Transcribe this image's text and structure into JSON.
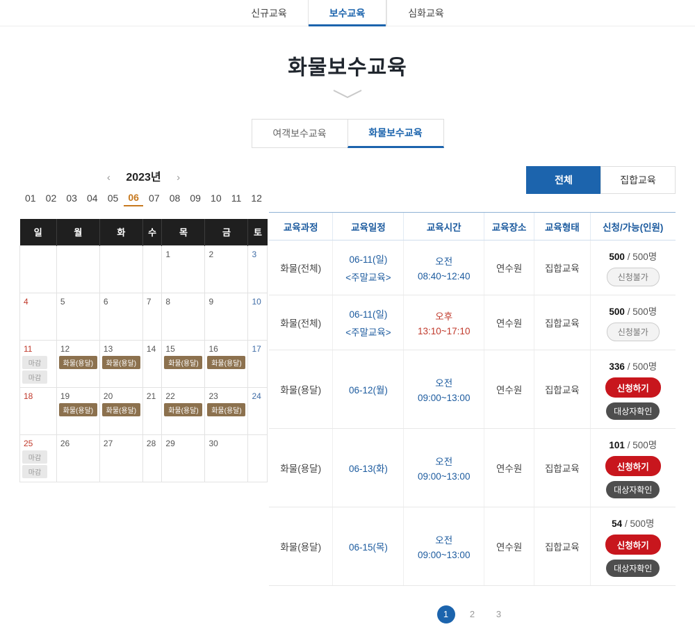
{
  "top_nav": {
    "tabs": [
      {
        "label": "신규교육",
        "active": false
      },
      {
        "label": "보수교육",
        "active": true
      },
      {
        "label": "심화교육",
        "active": false
      }
    ]
  },
  "page": {
    "title": "화물보수교육"
  },
  "sub_tabs": [
    {
      "label": "여객보수교육",
      "active": false
    },
    {
      "label": "화물보수교육",
      "active": true
    }
  ],
  "calendar": {
    "prev_label": "‹",
    "next_label": "›",
    "year": "2023년",
    "months": [
      "01",
      "02",
      "03",
      "04",
      "05",
      "06",
      "07",
      "08",
      "09",
      "10",
      "11",
      "12"
    ],
    "selected_month": "06",
    "weekdays": [
      "일",
      "월",
      "화",
      "수",
      "목",
      "금",
      "토"
    ],
    "weeks": [
      [
        {
          "day": ""
        },
        {
          "day": ""
        },
        {
          "day": ""
        },
        {
          "day": ""
        },
        {
          "day": "1"
        },
        {
          "day": "2"
        },
        {
          "day": "3",
          "type": "sat"
        }
      ],
      [
        {
          "day": "4",
          "type": "sun"
        },
        {
          "day": "5"
        },
        {
          "day": "6"
        },
        {
          "day": "7"
        },
        {
          "day": "8"
        },
        {
          "day": "9"
        },
        {
          "day": "10",
          "type": "sat"
        }
      ],
      [
        {
          "day": "11",
          "type": "sun",
          "badges": [
            {
              "label": "마감",
              "style": "closed"
            },
            {
              "label": "마감",
              "style": "closed"
            }
          ]
        },
        {
          "day": "12",
          "badges": [
            {
              "label": "화물(용달)",
              "style": "cargo"
            }
          ]
        },
        {
          "day": "13",
          "badges": [
            {
              "label": "화물(용달)",
              "style": "cargo"
            }
          ]
        },
        {
          "day": "14"
        },
        {
          "day": "15",
          "badges": [
            {
              "label": "화물(용달)",
              "style": "cargo"
            }
          ]
        },
        {
          "day": "16",
          "badges": [
            {
              "label": "화물(용달)",
              "style": "cargo"
            }
          ]
        },
        {
          "day": "17",
          "type": "sat"
        }
      ],
      [
        {
          "day": "18",
          "type": "sun"
        },
        {
          "day": "19",
          "badges": [
            {
              "label": "화물(용달)",
              "style": "cargo"
            }
          ]
        },
        {
          "day": "20",
          "badges": [
            {
              "label": "화물(용달)",
              "style": "cargo"
            }
          ]
        },
        {
          "day": "21"
        },
        {
          "day": "22",
          "badges": [
            {
              "label": "화물(용달)",
              "style": "cargo"
            }
          ]
        },
        {
          "day": "23",
          "badges": [
            {
              "label": "화물(용달)",
              "style": "cargo"
            }
          ]
        },
        {
          "day": "24",
          "type": "sat"
        }
      ],
      [
        {
          "day": "25",
          "type": "sun",
          "badges": [
            {
              "label": "마감",
              "style": "closed"
            },
            {
              "label": "마감",
              "style": "closed"
            }
          ]
        },
        {
          "day": "26"
        },
        {
          "day": "27"
        },
        {
          "day": "28"
        },
        {
          "day": "29"
        },
        {
          "day": "30"
        },
        {
          "day": ""
        }
      ]
    ]
  },
  "filters": [
    {
      "label": "전체",
      "active": true
    },
    {
      "label": "집합교육",
      "active": false
    }
  ],
  "table": {
    "headers": [
      "교육과정",
      "교육일정",
      "교육시간",
      "교육장소",
      "교육형태",
      "신청/가능(인원)"
    ],
    "rows": [
      {
        "course": "화물(전체)",
        "date": "06-11(일)",
        "date_note": "<주말교육>",
        "period": "오전",
        "time": "08:40~12:40",
        "time_style": "blue",
        "place": "연수원",
        "type": "집합교육",
        "count": "500",
        "capacity": "500명",
        "buttons": [
          {
            "label": "신청불가",
            "style": "disabled"
          }
        ]
      },
      {
        "course": "화물(전체)",
        "date": "06-11(일)",
        "date_note": "<주말교육>",
        "period": "오후",
        "time": "13:10~17:10",
        "time_style": "red",
        "place": "연수원",
        "type": "집합교육",
        "count": "500",
        "capacity": "500명",
        "buttons": [
          {
            "label": "신청불가",
            "style": "disabled"
          }
        ]
      },
      {
        "course": "화물(용달)",
        "date": "06-12(월)",
        "date_note": "",
        "period": "오전",
        "time": "09:00~13:00",
        "time_style": "blue",
        "place": "연수원",
        "type": "집합교육",
        "count": "336",
        "capacity": "500명",
        "buttons": [
          {
            "label": "신청하기",
            "style": "apply"
          },
          {
            "label": "대상자확인",
            "style": "target"
          }
        ]
      },
      {
        "course": "화물(용달)",
        "date": "06-13(화)",
        "date_note": "",
        "period": "오전",
        "time": "09:00~13:00",
        "time_style": "blue",
        "place": "연수원",
        "type": "집합교육",
        "count": "101",
        "capacity": "500명",
        "buttons": [
          {
            "label": "신청하기",
            "style": "apply"
          },
          {
            "label": "대상자확인",
            "style": "target"
          }
        ]
      },
      {
        "course": "화물(용달)",
        "date": "06-15(목)",
        "date_note": "",
        "period": "오전",
        "time": "09:00~13:00",
        "time_style": "blue",
        "place": "연수원",
        "type": "집합교육",
        "count": "54",
        "capacity": "500명",
        "buttons": [
          {
            "label": "신청하기",
            "style": "apply"
          },
          {
            "label": "대상자확인",
            "style": "target"
          }
        ]
      }
    ]
  },
  "pagination": [
    {
      "label": "1",
      "active": true
    },
    {
      "label": "2",
      "active": false
    },
    {
      "label": "3",
      "active": false
    }
  ],
  "colors": {
    "accent_blue": "#1c64ad",
    "link_blue": "#1b5a9e",
    "apply_red": "#c8161d",
    "badge_brown": "#8c714e",
    "sunday_red": "#c0392b",
    "saturday_blue": "#3f6ca6",
    "month_selected": "#c7791f"
  }
}
